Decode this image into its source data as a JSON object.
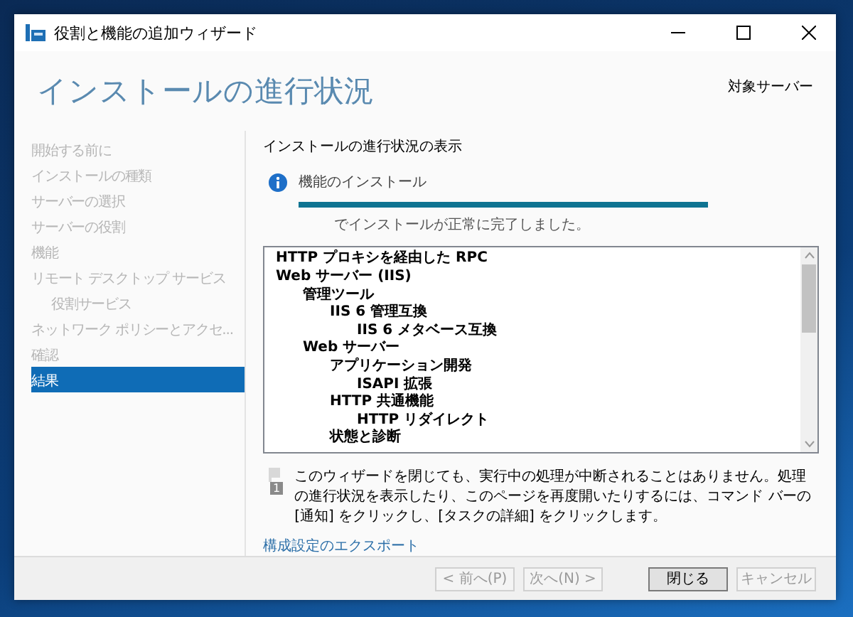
{
  "window": {
    "title": "役割と機能の追加ウィザード"
  },
  "header": {
    "title": "インストールの進行状況",
    "target_label": "対象サーバー"
  },
  "sidebar": {
    "items": [
      {
        "label": "開始する前に",
        "selected": false,
        "disabled": true
      },
      {
        "label": "インストールの種類",
        "selected": false,
        "disabled": true
      },
      {
        "label": "サーバーの選択",
        "selected": false,
        "disabled": true
      },
      {
        "label": "サーバーの役割",
        "selected": false,
        "disabled": true
      },
      {
        "label": "機能",
        "selected": false,
        "disabled": true
      },
      {
        "label": "リモート デスクトップ サービス",
        "selected": false,
        "disabled": true,
        "children": [
          {
            "label": "役割サービス",
            "selected": false,
            "disabled": true
          }
        ]
      },
      {
        "label": "ネットワーク ポリシーとアクセ...",
        "selected": false,
        "disabled": true
      },
      {
        "label": "確認",
        "selected": false,
        "disabled": true
      },
      {
        "label": "結果",
        "selected": true,
        "disabled": false
      }
    ]
  },
  "content": {
    "heading": "インストールの進行状況の表示",
    "status": {
      "label": "機能のインストール",
      "level": 1,
      "message": "でインストールが正常に完了しました。"
    },
    "results": [
      {
        "label": "HTTP プロキシを経由した RPC"
      },
      {
        "label": "Web サーバー (IIS)",
        "children": [
          {
            "label": "管理ツール",
            "children": [
              {
                "label": "IIS 6 管理互換",
                "children": [
                  {
                    "label": "IIS 6 メタベース互換"
                  }
                ]
              }
            ]
          },
          {
            "label": "Web サーバー",
            "children": [
              {
                "label": "アプリケーション開発",
                "children": [
                  {
                    "label": "ISAPI 拡張"
                  }
                ]
              },
              {
                "label": "HTTP 共通機能",
                "children": [
                  {
                    "label": "HTTP リダイレクト"
                  }
                ]
              },
              {
                "label": "状態と診断"
              }
            ]
          }
        ]
      }
    ],
    "notice": "このウィザードを閉じても、実行中の処理が中断されることはありません。処理の進行状況を表示したり、このページを再度開いたりするには、コマンド バーの [通知] をクリックし、[タスクの詳細] をクリックします。",
    "notice_badge": "1",
    "export_link": "構成設定のエクスポート"
  },
  "buttons": [
    {
      "label": "< 前へ(P)",
      "disabled": true,
      "default": false
    },
    {
      "label": "次へ(N) >",
      "disabled": true,
      "default": false
    },
    {
      "label": "閉じる",
      "disabled": false,
      "default": true
    },
    {
      "label": "キャンセル",
      "disabled": true,
      "default": false
    }
  ]
}
